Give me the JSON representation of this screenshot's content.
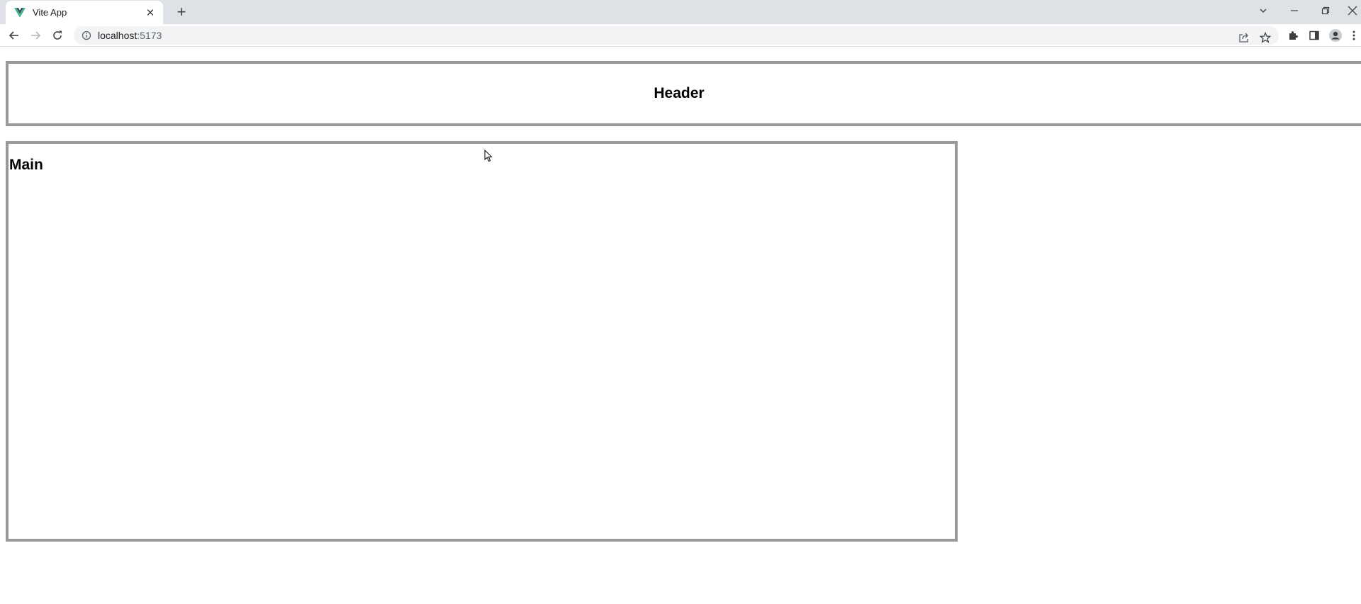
{
  "browser": {
    "tab": {
      "title": "Vite App",
      "close_glyph": "✕"
    },
    "new_tab_glyph": "+",
    "address": {
      "host": "localhost",
      "port": ":5173"
    },
    "icons": {
      "favicon": "vue-logo-icon",
      "back": "back-arrow-icon",
      "forward": "forward-arrow-icon",
      "reload": "reload-icon",
      "site_info": "info-icon",
      "share": "share-icon",
      "bookmark": "star-icon",
      "extensions": "puzzle-icon",
      "side_panel": "side-panel-icon",
      "profile": "profile-icon",
      "menu": "kebab-menu-icon"
    },
    "colors": {
      "tabstrip": "#dee1e6",
      "omnibox": "#f1f3f4",
      "favicon_green": "#41b883",
      "favicon_dark": "#34495e"
    }
  },
  "page": {
    "header": {
      "title": "Header"
    },
    "main": {
      "title": "Main"
    },
    "colors": {
      "box_border": "#999999"
    }
  }
}
